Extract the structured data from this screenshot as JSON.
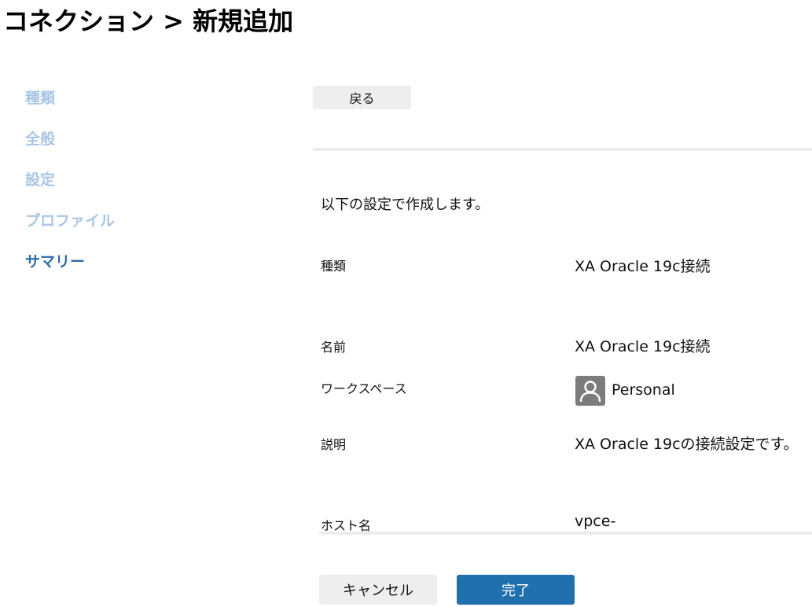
{
  "header": {
    "title": "コネクション > 新規追加"
  },
  "stepper": {
    "steps": [
      {
        "label": "種類"
      },
      {
        "label": "全般"
      },
      {
        "label": "設定"
      },
      {
        "label": "プロファイル"
      },
      {
        "label": "サマリー"
      }
    ],
    "active_step": "サマリー"
  },
  "toolbar": {
    "back_label": "戻る"
  },
  "summary": {
    "intro": "以下の設定で作成します。",
    "rows": [
      {
        "label": "種類",
        "value": "XA Oracle 19c接続"
      },
      {
        "label": "名前",
        "value": "XA Oracle 19c接続"
      },
      {
        "label": "ワークスペース",
        "value": "Personal",
        "icon": "user-avatar-icon"
      },
      {
        "label": "説明",
        "value": "XA Oracle 19cの接続設定です。"
      },
      {
        "label": "ホスト名",
        "value": "vpce-"
      }
    ]
  },
  "footer": {
    "cancel_label": "キャンセル",
    "finish_label": "完了"
  },
  "colors": {
    "accent": "#2170ae",
    "step_active": "#2d6da6",
    "step_inactive": "#a8c6e4",
    "button_gray": "#eeeeee",
    "avatar_gray": "#7c7c7c"
  }
}
